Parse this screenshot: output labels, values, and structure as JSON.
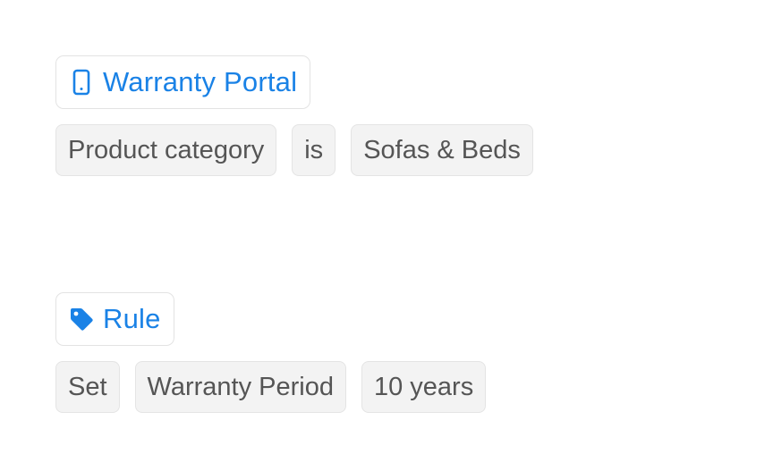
{
  "trigger": {
    "icon": "smartphone-icon",
    "label": "Warranty Portal",
    "condition": {
      "field": "Product category",
      "operator": "is",
      "value": "Sofas & Beds"
    }
  },
  "rule": {
    "icon": "tag-icon",
    "label": "Rule",
    "action": {
      "verb": "Set",
      "target": "Warranty Period",
      "value": "10 years"
    }
  },
  "colors": {
    "accent": "#1a82e6",
    "pill_bg": "#f3f3f3",
    "pill_text": "#555555",
    "border": "#e3e3e3"
  }
}
